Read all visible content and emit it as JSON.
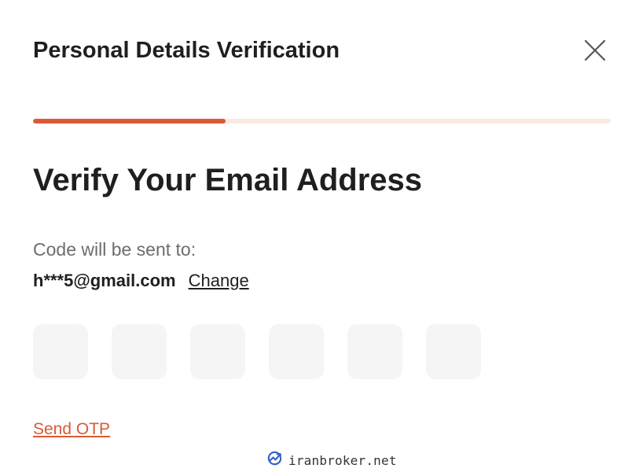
{
  "header": {
    "title": "Personal Details Verification"
  },
  "progress": {
    "fraction": 0.333
  },
  "main": {
    "heading": "Verify Your Email Address",
    "sent_to_label": "Code will be sent to:",
    "email": "h***5@gmail.com",
    "change_label": "Change"
  },
  "otp": {
    "digits": [
      "",
      "",
      "",
      "",
      "",
      ""
    ]
  },
  "actions": {
    "send_otp_label": "Send OTP"
  },
  "watermark": {
    "text": "iranbroker.net"
  },
  "colors": {
    "accent": "#d95a34",
    "progress_track": "#fbe9e1",
    "otp_box": "#f5f5f5",
    "muted_text": "#6d6d6d"
  }
}
